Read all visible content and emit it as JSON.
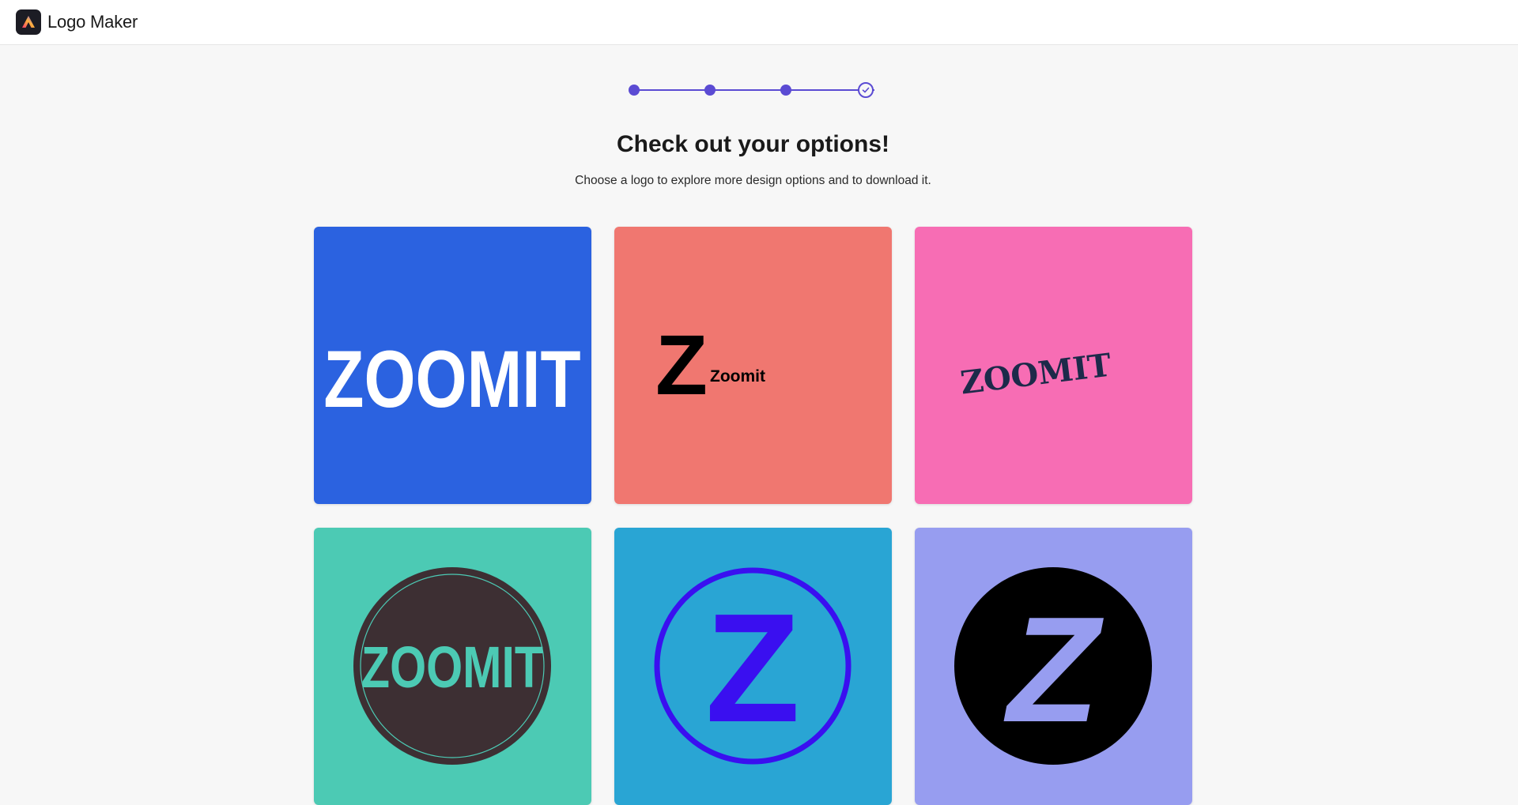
{
  "app": {
    "title": "Logo Maker",
    "icon": "adobe-express-icon"
  },
  "stepper": {
    "total_steps": 4,
    "current_step": 4,
    "accent_color": "#5b4bd3"
  },
  "page": {
    "heading": "Check out your options!",
    "subheading": "Choose a logo to explore more design options and to download it."
  },
  "logos": [
    {
      "background": "#2b62e0",
      "text": "ZOOMIT",
      "text_color": "#ffffff",
      "style": "condensed-wordmark"
    },
    {
      "background": "#f07770",
      "monogram": "Z",
      "text": "Zoomit",
      "text_color": "#000000",
      "style": "monogram-with-name"
    },
    {
      "background": "#f76db4",
      "text": "ZOOMIT",
      "text_color": "#1d2a4a",
      "style": "tilted-slab-wordmark"
    },
    {
      "background": "#4ccab4",
      "text": "ZOOMIT",
      "text_color": "#4ccab4",
      "badge_color": "#3d2f33",
      "style": "circle-badge-wordmark"
    },
    {
      "background": "#29a5d4",
      "monogram": "Z",
      "text_color": "#3a0ff0",
      "style": "ring-monogram"
    },
    {
      "background": "#979df0",
      "monogram": "Z",
      "text_color": "#979df0",
      "badge_color": "#000000",
      "style": "solid-circle-monogram"
    }
  ]
}
